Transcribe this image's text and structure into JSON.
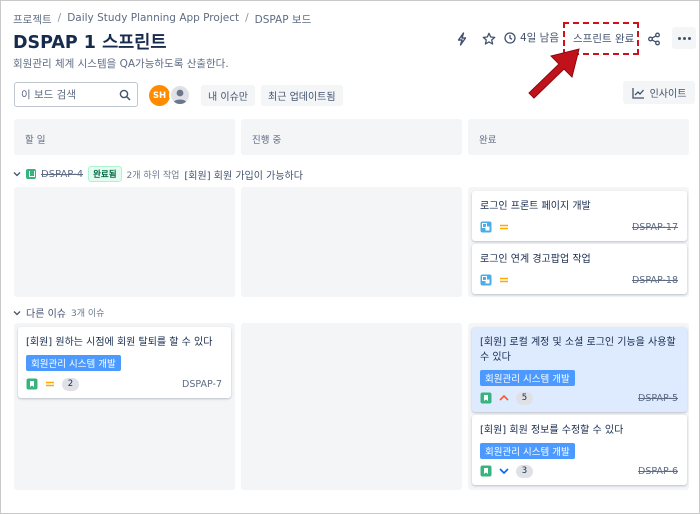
{
  "breadcrumbs": [
    "프로젝트",
    "Daily Study Planning App Project",
    "DSPAP 보드"
  ],
  "header": {
    "title": "DSPAP 1 스프린트",
    "subtitle": "회원관리 체계 시스템을 QA가능하도록 산출한다.",
    "days_left": "4일 남음",
    "complete_sprint_label": "스프린트 완료"
  },
  "toolbar": {
    "search_placeholder": "이 보드 검색",
    "avatar_initials": "SH",
    "my_issues_label": "내 이슈만",
    "recently_updated_label": "최근 업데이트됨",
    "insights_label": "인사이트"
  },
  "columns": [
    "할 일",
    "진행 중",
    "완료"
  ],
  "swimlanes": [
    {
      "key": "DSPAP-4",
      "status": "완료됨",
      "subtasks": "2개 하위 작업",
      "title": "[회원] 회원 가입이 가능하다",
      "done_cards": [
        {
          "title": "로그인 프론트 페이지 개발",
          "key": "DSPAP-17"
        },
        {
          "title": "로그인 연계 경고팝업 작업",
          "key": "DSPAP-18"
        }
      ]
    }
  ],
  "other_issues": {
    "label": "다른 이슈",
    "count": "3개 이슈",
    "todo_card": {
      "title": "[회원] 원하는 시점에 회원 탈퇴를 할 수 있다",
      "epic": "회원관리 시스템 개발",
      "points": "2",
      "key": "DSPAP-7"
    },
    "done_cards": [
      {
        "title": "[회원] 로컬 계정 및 소셜 로그인 기능을 사용할 수 있다",
        "epic": "회원관리 시스템 개발",
        "points": "5",
        "key": "DSPAP-5"
      },
      {
        "title": "[회원] 회원 정보를 수정할 수 있다",
        "epic": "회원관리 시스템 개발",
        "points": "3",
        "key": "DSPAP-6"
      }
    ]
  },
  "colors": {
    "accent": "#0052cc",
    "epic": "#4c9aff",
    "story": "#36b37e",
    "subtask": "#4bade8",
    "priority_medium": "#ffab00",
    "priority_high": "#ff5630",
    "priority_low": "#0065ff",
    "highlight": "#d0101a"
  }
}
